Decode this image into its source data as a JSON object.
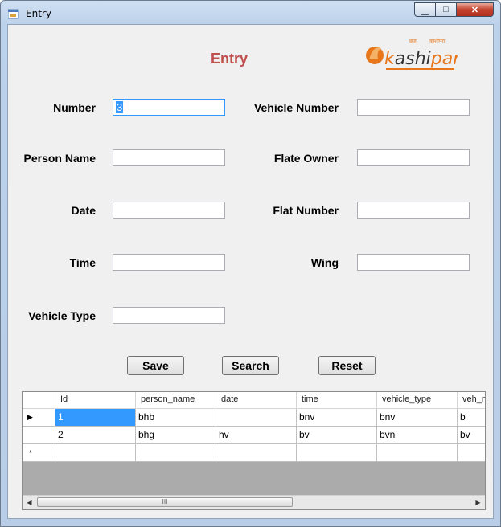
{
  "window": {
    "title": "Entry",
    "controls": {
      "minimize": "▁",
      "maximize": "□",
      "close": "✕"
    }
  },
  "heading": "Entry",
  "logo": {
    "text_a": "k",
    "text_b": "ashi",
    "text_c": "para",
    "small_a": "छज",
    "small_b": "काशीपरा",
    "brand_color": "#e8761b"
  },
  "colors": {
    "heading": "#c0504d",
    "selection": "#3399ff",
    "grid_bg": "#ababab"
  },
  "form": {
    "number": {
      "label": "Number",
      "value": "3"
    },
    "person_name": {
      "label": "Person Name",
      "value": ""
    },
    "date": {
      "label": "Date",
      "value": ""
    },
    "time": {
      "label": "Time",
      "value": ""
    },
    "vehicle_type": {
      "label": "Vehicle Type",
      "value": ""
    },
    "vehicle_number": {
      "label": "Vehicle Number",
      "value": ""
    },
    "flate_owner": {
      "label": "Flate Owner",
      "value": ""
    },
    "flat_number": {
      "label": "Flat Number",
      "value": ""
    },
    "wing": {
      "label": "Wing",
      "value": ""
    }
  },
  "buttons": {
    "save": "Save",
    "search": "Search",
    "reset": "Reset"
  },
  "grid": {
    "columns": [
      "Id",
      "person_name",
      "date",
      "time",
      "vehicle_type",
      "veh_n"
    ],
    "rows": [
      [
        "1",
        "bhb",
        "",
        "bnv",
        "bnv",
        "b"
      ],
      [
        "2",
        "bhg",
        "hv",
        "bv",
        "bvn",
        "bv"
      ]
    ],
    "current_row_marker": "▶",
    "new_row_marker": "*",
    "scroll_left": "◀",
    "scroll_right": "▶",
    "thumb_grip": "III"
  }
}
